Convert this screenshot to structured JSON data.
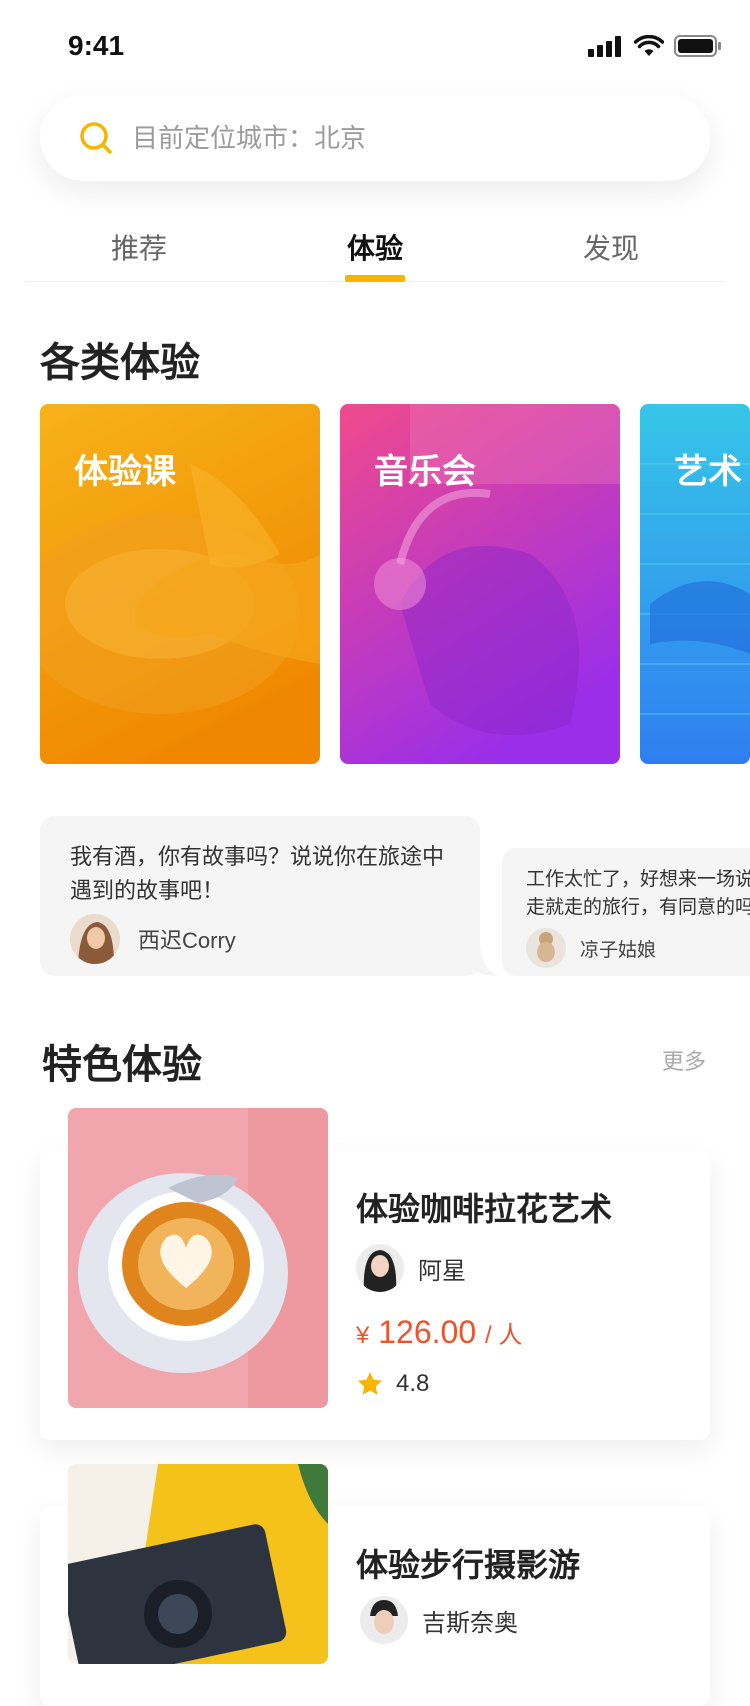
{
  "status": {
    "time": "9:41"
  },
  "search": {
    "placeholder": "目前定位城市：北京"
  },
  "tabs": [
    {
      "label": "推荐",
      "active": false
    },
    {
      "label": "体验",
      "active": true
    },
    {
      "label": "发现",
      "active": false
    }
  ],
  "categories_section": {
    "title": "各类体验",
    "cards": [
      {
        "label": "体验课",
        "icon": "pottery-photo"
      },
      {
        "label": "音乐会",
        "icon": "headphones-photo"
      },
      {
        "label": "艺术",
        "icon": "graffiti-photo"
      }
    ]
  },
  "stories": [
    {
      "text": "我有酒，你有故事吗？说说你在旅途中遇到的故事吧！",
      "user": "西迟Corry"
    },
    {
      "text": "工作太忙了，好想来一场说走就走的旅行，有同意的吗～",
      "user": "凉子姑娘"
    }
  ],
  "featured_section": {
    "title": "特色体验",
    "more": "更多",
    "items": [
      {
        "title": "体验咖啡拉花艺术",
        "host": "阿星",
        "currency": "¥",
        "price": "126.00",
        "unit": "/ 人",
        "rating": "4.8"
      },
      {
        "title": "体验步行摄影游",
        "host": "吉斯奈奥"
      }
    ]
  },
  "colors": {
    "accent": "#f7b500",
    "price": "#f0522c"
  }
}
